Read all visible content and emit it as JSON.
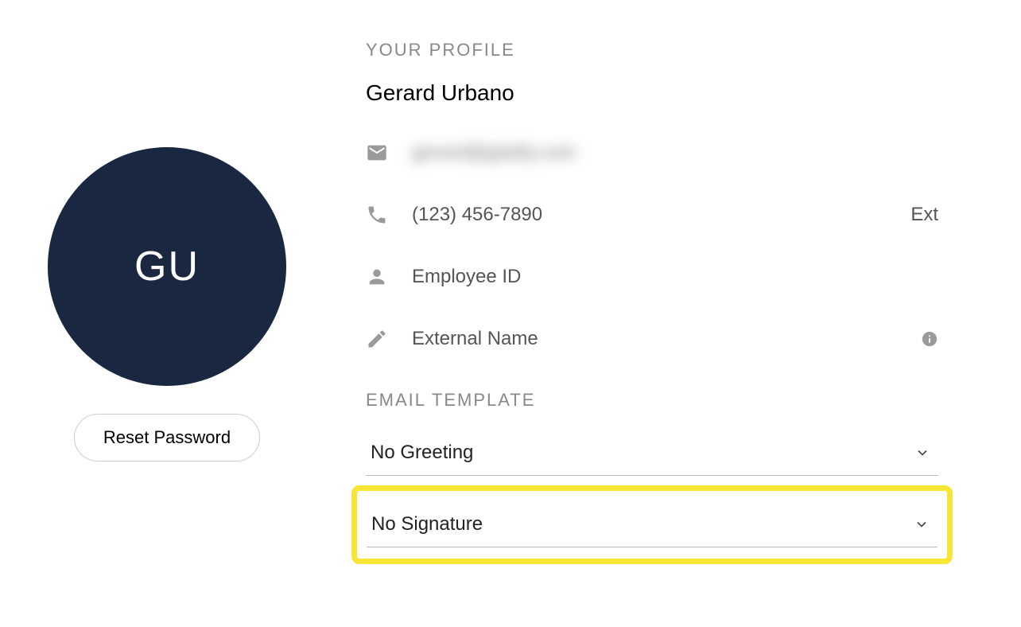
{
  "profile": {
    "section_header": "YOUR PROFILE",
    "name": "Gerard Urbano",
    "initials": "GU",
    "email": "gerard@gladly.com",
    "phone": "(123) 456-7890",
    "ext_label": "Ext",
    "employee_id_label": "Employee ID",
    "external_name_label": "External Name"
  },
  "buttons": {
    "reset_password": "Reset Password"
  },
  "email_template": {
    "section_header": "EMAIL TEMPLATE",
    "greeting_selected": "No Greeting",
    "signature_selected": "No Signature"
  }
}
